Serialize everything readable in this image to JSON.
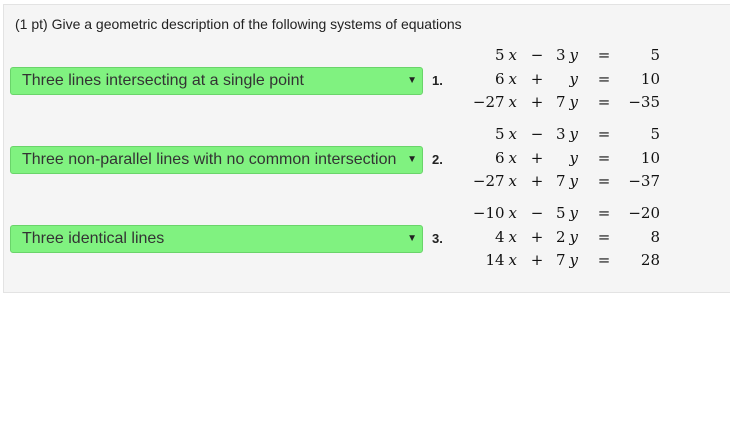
{
  "prompt": "(1 pt) Give a geometric description of the following systems of equations",
  "problems": [
    {
      "number": "1.",
      "selected": "Three lines intersecting at a single point",
      "equations": [
        {
          "a": "5",
          "op": "−",
          "b": "3",
          "rhs": "5"
        },
        {
          "a": "6",
          "op": "+",
          "b": "",
          "rhs": "10"
        },
        {
          "a": "−27",
          "op": "+",
          "b": "7",
          "rhs": "−35"
        }
      ]
    },
    {
      "number": "2.",
      "selected": "Three non-parallel lines with no common intersection",
      "equations": [
        {
          "a": "5",
          "op": "−",
          "b": "3",
          "rhs": "5"
        },
        {
          "a": "6",
          "op": "+",
          "b": "",
          "rhs": "10"
        },
        {
          "a": "−27",
          "op": "+",
          "b": "7",
          "rhs": "−37"
        }
      ]
    },
    {
      "number": "3.",
      "selected": "Three identical lines",
      "equations": [
        {
          "a": "−10",
          "op": "−",
          "b": "5",
          "rhs": "−20"
        },
        {
          "a": "4",
          "op": "+",
          "b": "2",
          "rhs": "8"
        },
        {
          "a": "14",
          "op": "+",
          "b": "7",
          "rhs": "28"
        }
      ]
    }
  ],
  "symbols": {
    "x": "x",
    "y": "y",
    "equals": "="
  },
  "dropdown_icon": "triangle-down-icon",
  "colors": {
    "select_bg": "#80f280",
    "panel_bg": "#f5f5f5"
  }
}
